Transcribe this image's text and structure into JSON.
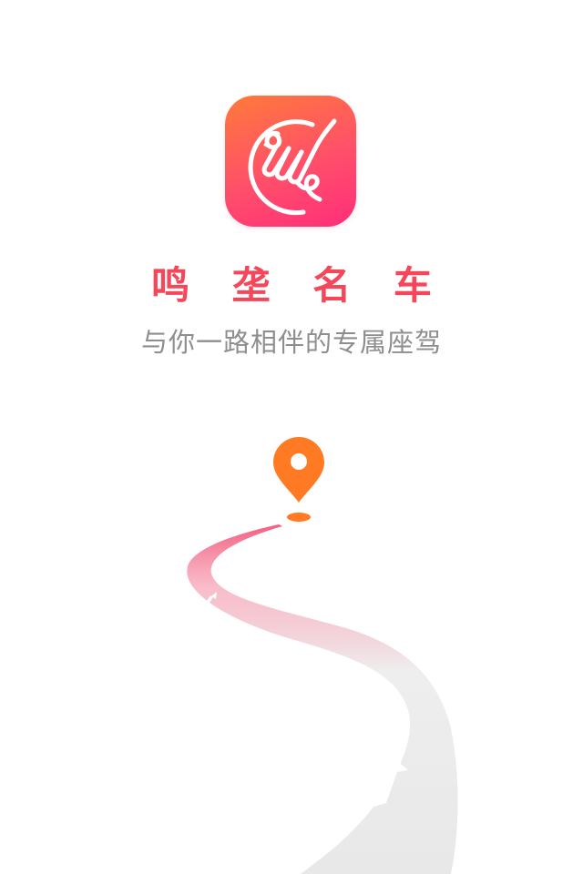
{
  "app": {
    "name": "鸣 垄 名 车",
    "slogan": "与你一路相伴的专属座驾"
  },
  "icons": {
    "logo": "horse-head-logo-icon",
    "location": "location-pin-icon",
    "arrow_small": "up-arrow-icon",
    "arrow_large": "up-arrow-icon"
  },
  "colors": {
    "brand_red": "#f5465a",
    "icon_gradient_start": "#ff7a3a",
    "icon_gradient_end": "#ff2e7a",
    "pin_orange": "#ff7a22",
    "road_gray": "#ececec",
    "text_gray": "#8e8e8e"
  }
}
